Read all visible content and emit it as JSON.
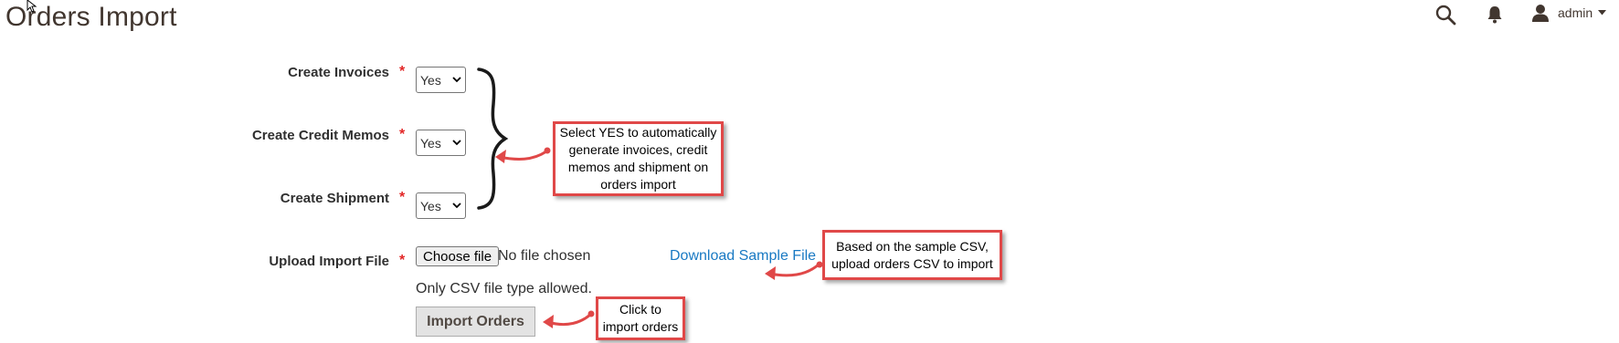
{
  "header": {
    "title": "Orders Import",
    "icons": [
      "search-icon",
      "bell-icon",
      "user-icon"
    ],
    "admin_label": "admin"
  },
  "form": {
    "invoices": {
      "label": "Create Invoices",
      "value": "Yes"
    },
    "credit_memos": {
      "label": "Create Credit Memos",
      "value": "Yes"
    },
    "shipment": {
      "label": "Create Shipment",
      "value": "Yes"
    },
    "upload": {
      "label": "Upload Import File",
      "choose_label": "Choose file",
      "status": "No file chosen",
      "hint": "Only CSV file type allowed.",
      "sample_link": "Download Sample File"
    },
    "import_button": "Import Orders"
  },
  "callouts": {
    "yes": [
      "Select YES to automatically",
      "generate invoices, credit",
      "memos and shipment on",
      "orders import"
    ],
    "sample": [
      "Based on the sample CSV,",
      "upload orders CSV to import"
    ],
    "import": [
      "Click to",
      "import orders"
    ]
  },
  "colors": {
    "annotation_red": "#e04848",
    "link_blue": "#1979c3",
    "required_red": "#e22626"
  }
}
